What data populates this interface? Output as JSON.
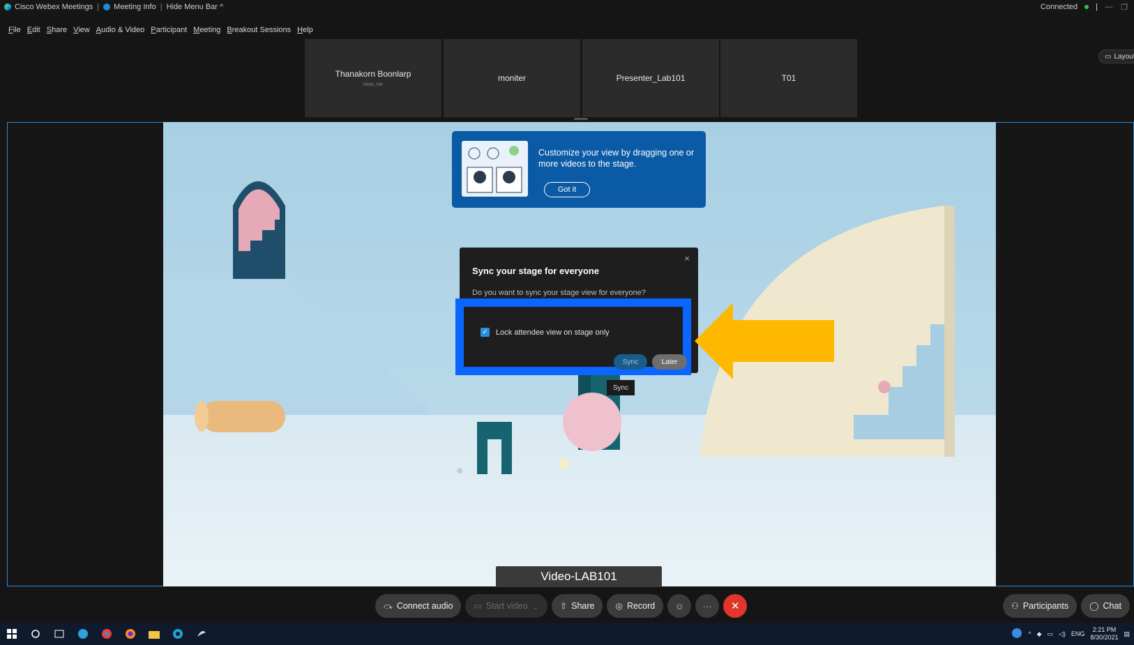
{
  "titlebar": {
    "app_name": "Cisco Webex Meetings",
    "meeting_info": "Meeting Info",
    "hide_menu": "Hide Menu Bar ^",
    "status": "Connected"
  },
  "menu": [
    "File",
    "Edit",
    "Share",
    "View",
    "Audio & Video",
    "Participant",
    "Meeting",
    "Breakout Sessions",
    "Help"
  ],
  "participants": [
    {
      "name": "Thanakorn Boonlarp",
      "sub": "Host, me"
    },
    {
      "name": "moniter",
      "sub": ""
    },
    {
      "name": "Presenter_Lab101",
      "sub": ""
    },
    {
      "name": "T01",
      "sub": ""
    }
  ],
  "layout_label": "Layout",
  "tip": {
    "message": "Customize your view by dragging one or more videos to the stage.",
    "button": "Got it"
  },
  "dialog": {
    "title": "Sync your stage for everyone",
    "question": "Do you want to sync your stage view for everyone?",
    "checkbox_label": "Lock attendee view on stage only",
    "checkbox_checked": true,
    "sync": "Sync",
    "later": "Later",
    "tooltip": "Sync",
    "close": "×"
  },
  "stage_name": "Video-LAB101",
  "controls": {
    "connect_audio": "Connect audio",
    "start_video": "Start video",
    "share": "Share",
    "record": "Record",
    "participants": "Participants",
    "chat": "Chat"
  },
  "taskbar": {
    "lang": "ENG",
    "time": "2:21 PM",
    "date": "8/30/2021"
  },
  "colors": {
    "accent": "#0a66ff",
    "arrow": "#ffb800",
    "end_call": "#e0362c",
    "tip_bg": "#0a5aa6"
  }
}
